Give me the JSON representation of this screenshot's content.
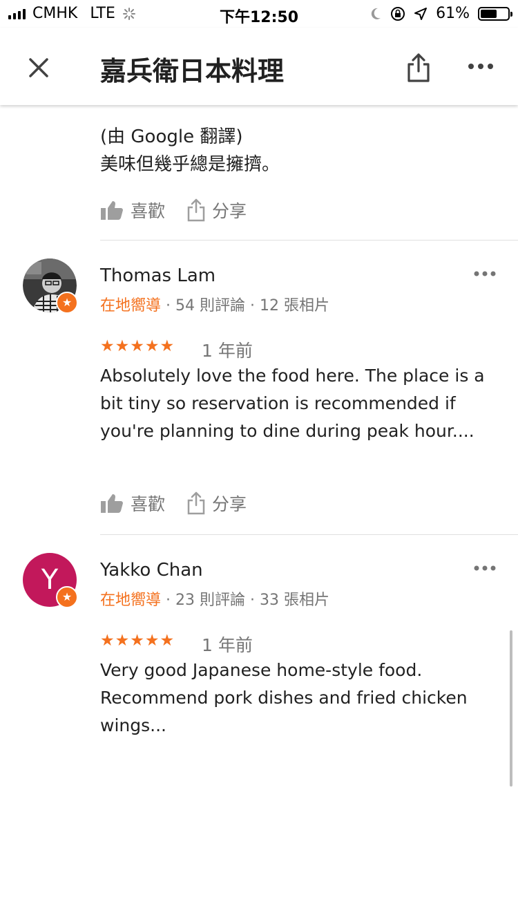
{
  "status_bar": {
    "carrier": "CMHK",
    "network": "LTE",
    "time": "下午12:50",
    "battery": "61%",
    "battery_level": 0.61
  },
  "app_bar": {
    "title": "嘉兵衛日本料理",
    "close_icon": "close-icon",
    "share_icon": "share-icon",
    "more_icon": "more-horizontal-icon"
  },
  "previous_review": {
    "translated_label": "(由 Google 翻譯)",
    "text": "美味但幾乎總是擁擠。",
    "like_label": "喜歡",
    "share_label": "分享"
  },
  "reviews": [
    {
      "name": "Thomas Lam",
      "guide_label": "在地嚮導",
      "review_count": "54 則評論",
      "photo_count": "12 張相片",
      "stars": "★★★★★",
      "rating": 5,
      "time": "1 年前",
      "text": "Absolutely love the food here. The place is a bit tiny so reservation is recommended if you're planning to dine during peak hour....",
      "like_label": "喜歡",
      "share_label": "分享"
    },
    {
      "name": "Yakko Chan",
      "initial": "Y",
      "guide_label": "在地嚮導",
      "review_count": "23 則評論",
      "photo_count": "33 張相片",
      "stars": "★★★★★",
      "rating": 5,
      "time": "1 年前",
      "text": "Very good Japanese home-style food. Recommend pork dishes and fried chicken wings...",
      "avatar_color": "#c2185b"
    }
  ],
  "colors": {
    "accent": "#f4711e",
    "secondary_text": "#757575"
  }
}
